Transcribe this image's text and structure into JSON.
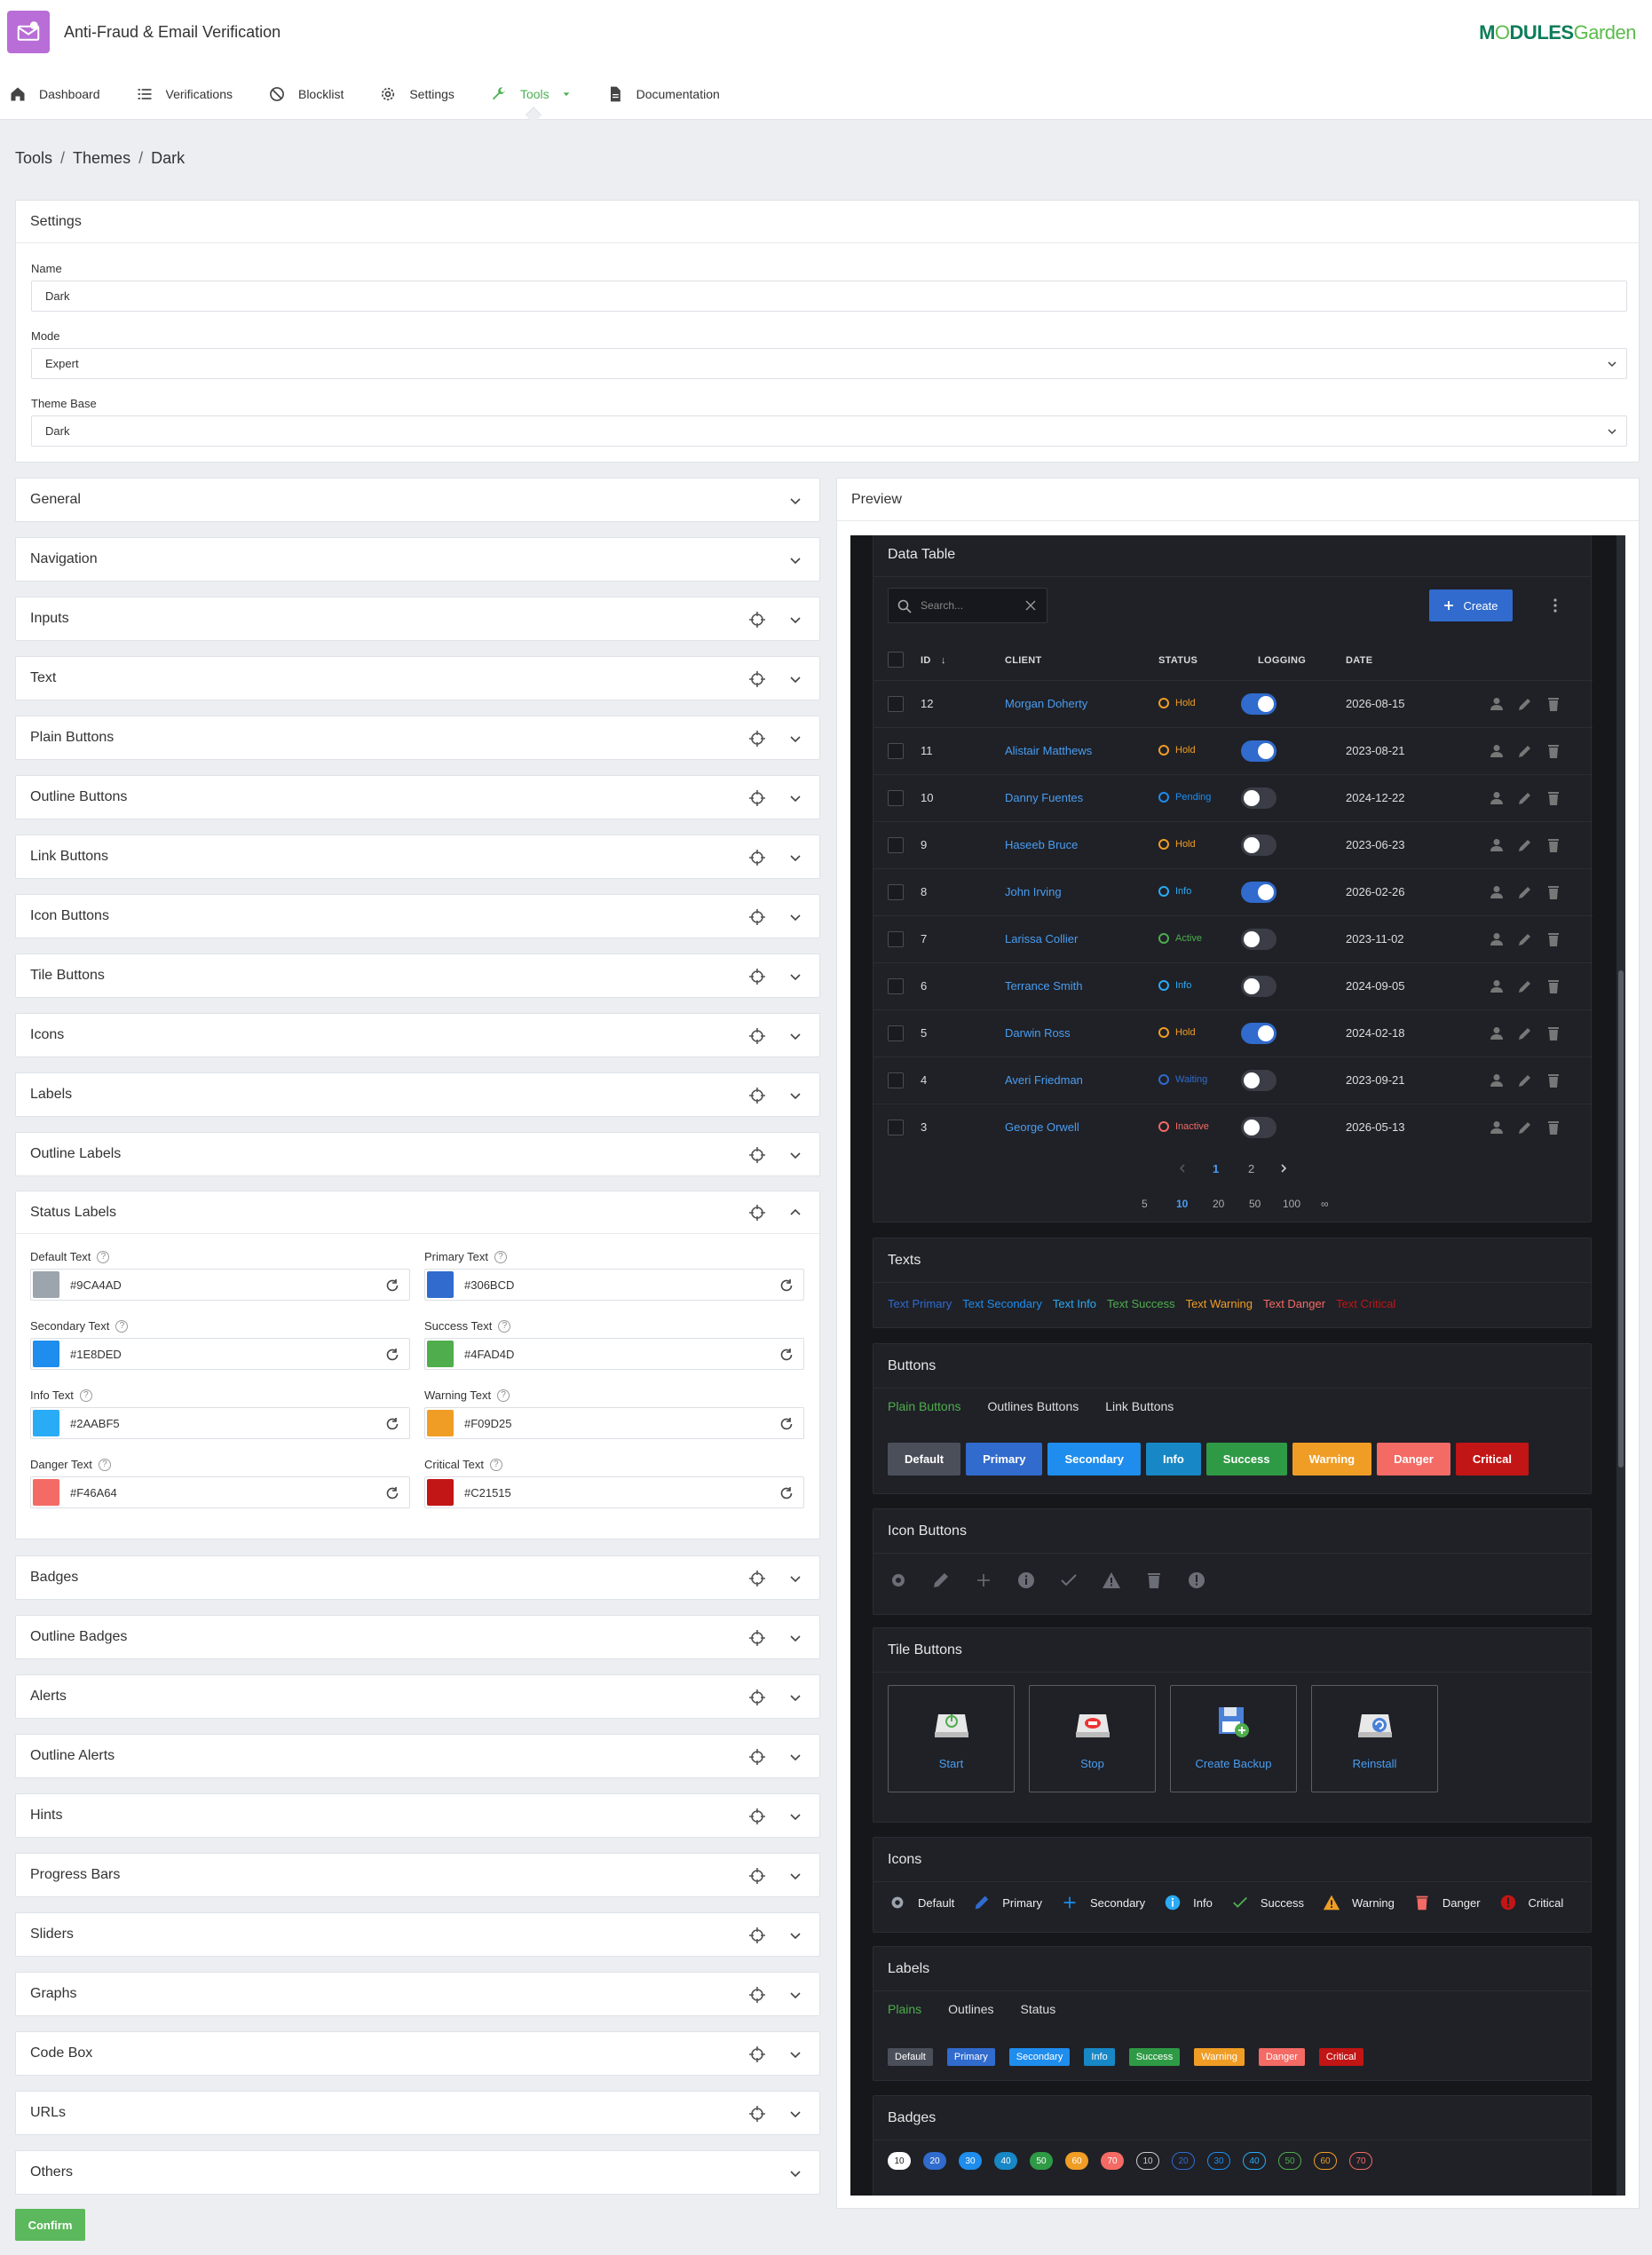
{
  "app": {
    "title": "Anti-Fraud & Email Verification",
    "brand_main": "M",
    "brand_o": "O",
    "brand_rest": "DULES",
    "brand_garden": "Garden"
  },
  "nav": [
    {
      "label": "Dashboard",
      "icon": "home-icon"
    },
    {
      "label": "Verifications",
      "icon": "list-icon"
    },
    {
      "label": "Blocklist",
      "icon": "ban-icon"
    },
    {
      "label": "Settings",
      "icon": "gear-icon"
    },
    {
      "label": "Tools",
      "icon": "wrench-icon",
      "active": true
    },
    {
      "label": "Documentation",
      "icon": "document-icon"
    }
  ],
  "breadcrumb": [
    "Tools",
    "Themes",
    "Dark"
  ],
  "settings": {
    "title": "Settings",
    "name_label": "Name",
    "name_value": "Dark",
    "mode_label": "Mode",
    "mode_value": "Expert",
    "base_label": "Theme Base",
    "base_value": "Dark"
  },
  "sections": [
    "General",
    "Navigation",
    "Inputs",
    "Text",
    "Plain Buttons",
    "Outline Buttons",
    "Link Buttons",
    "Icon Buttons",
    "Tile Buttons",
    "Icons",
    "Labels",
    "Outline Labels"
  ],
  "status_labels": {
    "title": "Status Labels",
    "colors": [
      {
        "label": "Default Text",
        "hex": "#9CA4AD"
      },
      {
        "label": "Primary Text",
        "hex": "#306BCD"
      },
      {
        "label": "Secondary Text",
        "hex": "#1E8DED"
      },
      {
        "label": "Success Text",
        "hex": "#4FAD4D"
      },
      {
        "label": "Info Text",
        "hex": "#2AABF5"
      },
      {
        "label": "Warning Text",
        "hex": "#F09D25"
      },
      {
        "label": "Danger Text",
        "hex": "#F46A64"
      },
      {
        "label": "Critical Text",
        "hex": "#C21515"
      }
    ]
  },
  "sections_after": [
    "Badges",
    "Outline Badges",
    "Alerts",
    "Outline Alerts",
    "Hints",
    "Progress Bars",
    "Sliders",
    "Graphs",
    "Code Box",
    "URLs",
    "Others"
  ],
  "confirm_label": "Confirm",
  "preview": {
    "title": "Preview",
    "data_table": {
      "title": "Data Table",
      "search_placeholder": "Search...",
      "create_label": "Create",
      "headers": {
        "id": "ID",
        "client": "CLIENT",
        "status": "STATUS",
        "logging": "LOGGING",
        "date": "DATE"
      },
      "rows": [
        {
          "id": "12",
          "client": "Morgan Doherty",
          "status": "Hold",
          "color": "#F09D25",
          "logging": true,
          "date": "2026-08-15"
        },
        {
          "id": "11",
          "client": "Alistair Matthews",
          "status": "Hold",
          "color": "#F09D25",
          "logging": true,
          "date": "2023-08-21"
        },
        {
          "id": "10",
          "client": "Danny Fuentes",
          "status": "Pending",
          "color": "#1E8DED",
          "logging": false,
          "date": "2024-12-22"
        },
        {
          "id": "9",
          "client": "Haseeb Bruce",
          "status": "Hold",
          "color": "#F09D25",
          "logging": false,
          "date": "2023-06-23"
        },
        {
          "id": "8",
          "client": "John Irving",
          "status": "Info",
          "color": "#2AABF5",
          "logging": true,
          "date": "2026-02-26"
        },
        {
          "id": "7",
          "client": "Larissa Collier",
          "status": "Active",
          "color": "#4FAD4D",
          "logging": false,
          "date": "2023-11-02"
        },
        {
          "id": "6",
          "client": "Terrance Smith",
          "status": "Info",
          "color": "#2AABF5",
          "logging": false,
          "date": "2024-09-05"
        },
        {
          "id": "5",
          "client": "Darwin Ross",
          "status": "Hold",
          "color": "#F09D25",
          "logging": true,
          "date": "2024-02-18"
        },
        {
          "id": "4",
          "client": "Averi Friedman",
          "status": "Waiting",
          "color": "#306BCD",
          "logging": false,
          "date": "2023-09-21"
        },
        {
          "id": "3",
          "client": "George Orwell",
          "status": "Inactive",
          "color": "#F46A64",
          "logging": false,
          "date": "2026-05-13"
        }
      ],
      "pages": [
        "1",
        "2"
      ],
      "page_sizes": [
        "5",
        "10",
        "20",
        "50",
        "100",
        "∞"
      ]
    },
    "texts": {
      "title": "Texts",
      "items": [
        {
          "label": "Text Primary",
          "color": "#306BCD"
        },
        {
          "label": "Text Secondary",
          "color": "#1E8DED"
        },
        {
          "label": "Text Info",
          "color": "#2AABF5"
        },
        {
          "label": "Text Success",
          "color": "#4FAD4D"
        },
        {
          "label": "Text Warning",
          "color": "#F09D25"
        },
        {
          "label": "Text Danger",
          "color": "#F46A64"
        },
        {
          "label": "Text Critical",
          "color": "#C21515"
        }
      ]
    },
    "buttons": {
      "title": "Buttons",
      "tabs": [
        "Plain Buttons",
        "Outlines Buttons",
        "Link Buttons"
      ],
      "items": [
        {
          "label": "Default",
          "color": "#4A4F5A"
        },
        {
          "label": "Primary",
          "color": "#306BCD"
        },
        {
          "label": "Secondary",
          "color": "#1E8DED"
        },
        {
          "label": "Info",
          "color": "#1787C5"
        },
        {
          "label": "Success",
          "color": "#2F9A45"
        },
        {
          "label": "Warning",
          "color": "#F09D25"
        },
        {
          "label": "Danger",
          "color": "#F46A64"
        },
        {
          "label": "Critical",
          "color": "#C21515"
        }
      ]
    },
    "icon_buttons": {
      "title": "Icon Buttons"
    },
    "tile_buttons": {
      "title": "Tile Buttons",
      "items": [
        "Start",
        "Stop",
        "Create Backup",
        "Reinstall"
      ]
    },
    "icons": {
      "title": "Icons",
      "items": [
        "Default",
        "Primary",
        "Secondary",
        "Info",
        "Success",
        "Warning",
        "Danger",
        "Critical"
      ]
    },
    "labels": {
      "title": "Labels",
      "tabs": [
        "Plains",
        "Outlines",
        "Status"
      ],
      "items": [
        {
          "label": "Default",
          "color": "#4A4F5A"
        },
        {
          "label": "Primary",
          "color": "#306BCD"
        },
        {
          "label": "Secondary",
          "color": "#1E8DED"
        },
        {
          "label": "Info",
          "color": "#1787C5"
        },
        {
          "label": "Success",
          "color": "#2F9A45"
        },
        {
          "label": "Warning",
          "color": "#F09D25"
        },
        {
          "label": "Danger",
          "color": "#F46A64"
        },
        {
          "label": "Critical",
          "color": "#C21515"
        }
      ]
    },
    "badges": {
      "title": "Badges",
      "solid": [
        {
          "v": "10",
          "color": "#FFFFFF"
        },
        {
          "v": "20",
          "color": "#306BCD"
        },
        {
          "v": "30",
          "color": "#1E8DED"
        },
        {
          "v": "40",
          "color": "#1787C5"
        },
        {
          "v": "50",
          "color": "#2F9A45"
        },
        {
          "v": "60",
          "color": "#F09D25"
        },
        {
          "v": "70",
          "color": "#F46A64"
        }
      ],
      "outline": [
        {
          "v": "10",
          "color": "#CCCCCC"
        },
        {
          "v": "20",
          "color": "#306BCD"
        },
        {
          "v": "30",
          "color": "#1E8DED"
        },
        {
          "v": "40",
          "color": "#2AABF5"
        },
        {
          "v": "50",
          "color": "#4FAD4D"
        },
        {
          "v": "60",
          "color": "#F09D25"
        },
        {
          "v": "70",
          "color": "#F46A64"
        }
      ]
    }
  }
}
